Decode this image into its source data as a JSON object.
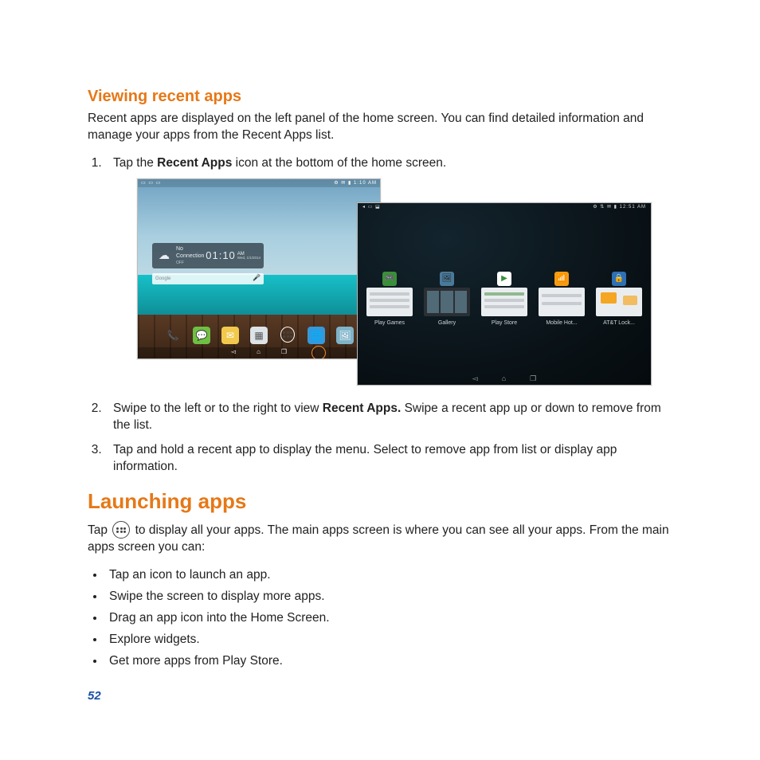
{
  "section1": {
    "title": "Viewing recent apps",
    "intro": "Recent apps are displayed on the left panel of the home screen. You can find detailed information and manage your apps from the Recent Apps list.",
    "step1_a": "Tap the ",
    "step1_bold": "Recent Apps",
    "step1_b": " icon at the bottom of the home screen.",
    "step2_a": "Swipe to the left or to the right to view ",
    "step2_bold": "Recent Apps.",
    "step2_b": " Swipe a recent app up or down to remove from the list.",
    "step3": "Tap and hold a recent app to display the menu. Select to remove app from list or display app information."
  },
  "section2": {
    "title": "Launching apps",
    "intro_a": "Tap ",
    "intro_b": " to display all your apps. The main apps screen is where you can see all your apps. From the main apps screen you can:",
    "bullets": [
      "Tap an icon to launch an app.",
      "Swipe the screen to display more apps.",
      "Drag an app icon into the Home Screen.",
      "Explore widgets.",
      "Get more apps from Play Store."
    ]
  },
  "pageNumber": "52",
  "shotA": {
    "statusLeft": "▭ ▭ ▭",
    "statusRight": "⚙ ✉ ▮ 1:10 AM",
    "noConnection": "No Connection",
    "time": "01:10",
    "ampm": "AM",
    "date": "Wed, 1/1/2014",
    "searchLabel": "Google",
    "off": "OFF"
  },
  "shotB": {
    "statusLeft": "◂ ▭ ⬓",
    "statusRight": "⚙ ⇅ ✉ ▮ 12:51 AM",
    "cards": [
      {
        "label": "Play Games"
      },
      {
        "label": "Gallery"
      },
      {
        "label": "Play Store"
      },
      {
        "label": "Mobile Hot..."
      },
      {
        "label": "AT&T Lock..."
      }
    ]
  }
}
